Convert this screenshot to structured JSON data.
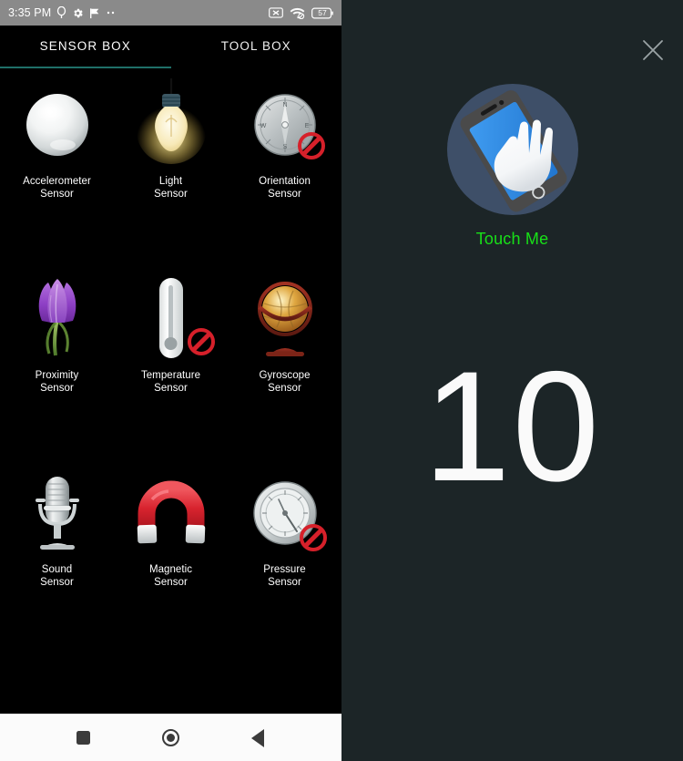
{
  "phone": {
    "status_bar": {
      "time": "3:35 PM",
      "left_icons": [
        "location-icon",
        "gear-icon",
        "flag-icon",
        "more-dots-icon"
      ],
      "right_icons": [
        "no-sim-icon",
        "wifi-off-icon"
      ],
      "battery_level": "57"
    },
    "tabs": [
      {
        "label": "SENSOR BOX",
        "active": true
      },
      {
        "label": "TOOL BOX",
        "active": false
      }
    ],
    "accent_color": "#1f6f68",
    "sensors": [
      {
        "name": "Accelerometer\nSensor",
        "line1": "Accelerometer",
        "line2": "Sensor",
        "icon": "silver-ball-icon",
        "disabled": false
      },
      {
        "name": "Light Sensor",
        "line1": "Light",
        "line2": "Sensor",
        "icon": "light-bulb-icon",
        "disabled": false
      },
      {
        "name": "Orientation Sensor",
        "line1": "Orientation",
        "line2": "Sensor",
        "icon": "compass-icon",
        "disabled": true
      },
      {
        "name": "Proximity Sensor",
        "line1": "Proximity",
        "line2": "Sensor",
        "icon": "crocus-flower-icon",
        "disabled": false
      },
      {
        "name": "Temperature Sensor",
        "line1": "Temperature",
        "line2": "Sensor",
        "icon": "thermometer-icon",
        "disabled": true
      },
      {
        "name": "Gyroscope Sensor",
        "line1": "Gyroscope",
        "line2": "Sensor",
        "icon": "globe-icon",
        "disabled": false
      },
      {
        "name": "Sound Sensor",
        "line1": "Sound",
        "line2": "Sensor",
        "icon": "microphone-icon",
        "disabled": false
      },
      {
        "name": "Magnetic Sensor",
        "line1": "Magnetic",
        "line2": "Sensor",
        "icon": "magnet-icon",
        "disabled": false
      },
      {
        "name": "Pressure Sensor",
        "line1": "Pressure",
        "line2": "Sensor",
        "icon": "barometer-gauge-icon",
        "disabled": true
      }
    ],
    "nav_bar": {
      "recents_label": "recents-square-icon",
      "home_label": "home-circle-icon",
      "back_label": "back-triangle-icon"
    }
  },
  "right_panel": {
    "background_color": "#1c2527",
    "close_icon": "close-icon",
    "app": {
      "name": "Touch Me",
      "name_color": "#18e018",
      "icon": "touch-me-app-icon"
    },
    "counter": "10",
    "counter_color": "#fafafa"
  }
}
